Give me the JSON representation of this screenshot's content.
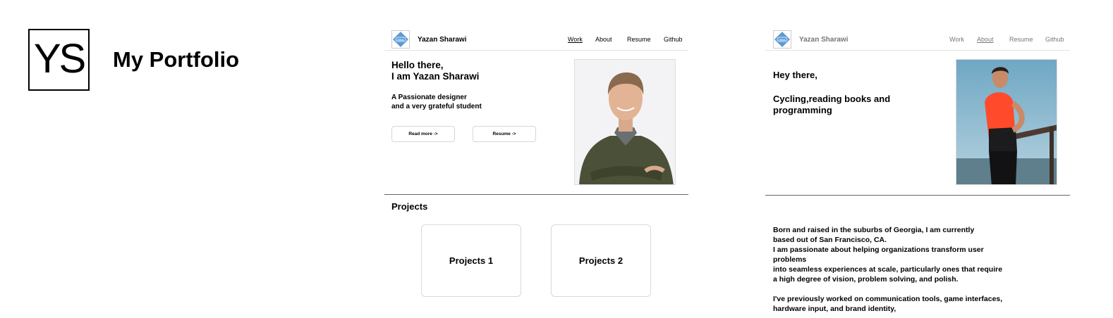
{
  "cover": {
    "logo_text": "YS",
    "title": "My Portfolio"
  },
  "home": {
    "brand_name": "Yazan Sharawi",
    "badge_text": "IXDA",
    "nav": [
      "Work",
      "About",
      "Resume",
      "Github"
    ],
    "active_nav": "Work",
    "hero_line1": "Hello there,",
    "hero_line2": "I am Yazan Sharawi",
    "sub_line1": "A Passionate designer",
    "sub_line2": "and a very grateful student",
    "buttons": {
      "read_more": "Read more ->",
      "resume": "Resume ->"
    },
    "projects_title": "Projects",
    "projects": [
      "Projects 1",
      "Projects 2"
    ]
  },
  "about": {
    "brand_name": "Yazan Sharawi",
    "badge_text": "IXDA",
    "nav": [
      "Work",
      "About",
      "Resume",
      "Github"
    ],
    "active_nav": "About",
    "greeting": "Hey there,",
    "interests_line1": "Cycling,reading books and",
    "interests_line2": "programming",
    "bio_paragraph1": "Born and raised in the suburbs of Georgia, I am currently\nbased out of San Francisco, CA.\nI am passionate about helping organizations transform user\nproblems\ninto seamless experiences at scale, particularly ones that require\na high degree of vision, problem solving, and polish.",
    "bio_paragraph2": "I've previously worked on communication tools, game interfaces,\nhardware input, and brand identity,"
  },
  "colors": {
    "badge_blue": "#5b9bd5",
    "divider": "#666666"
  },
  "icons": [
    "ixda-badge-icon"
  ]
}
